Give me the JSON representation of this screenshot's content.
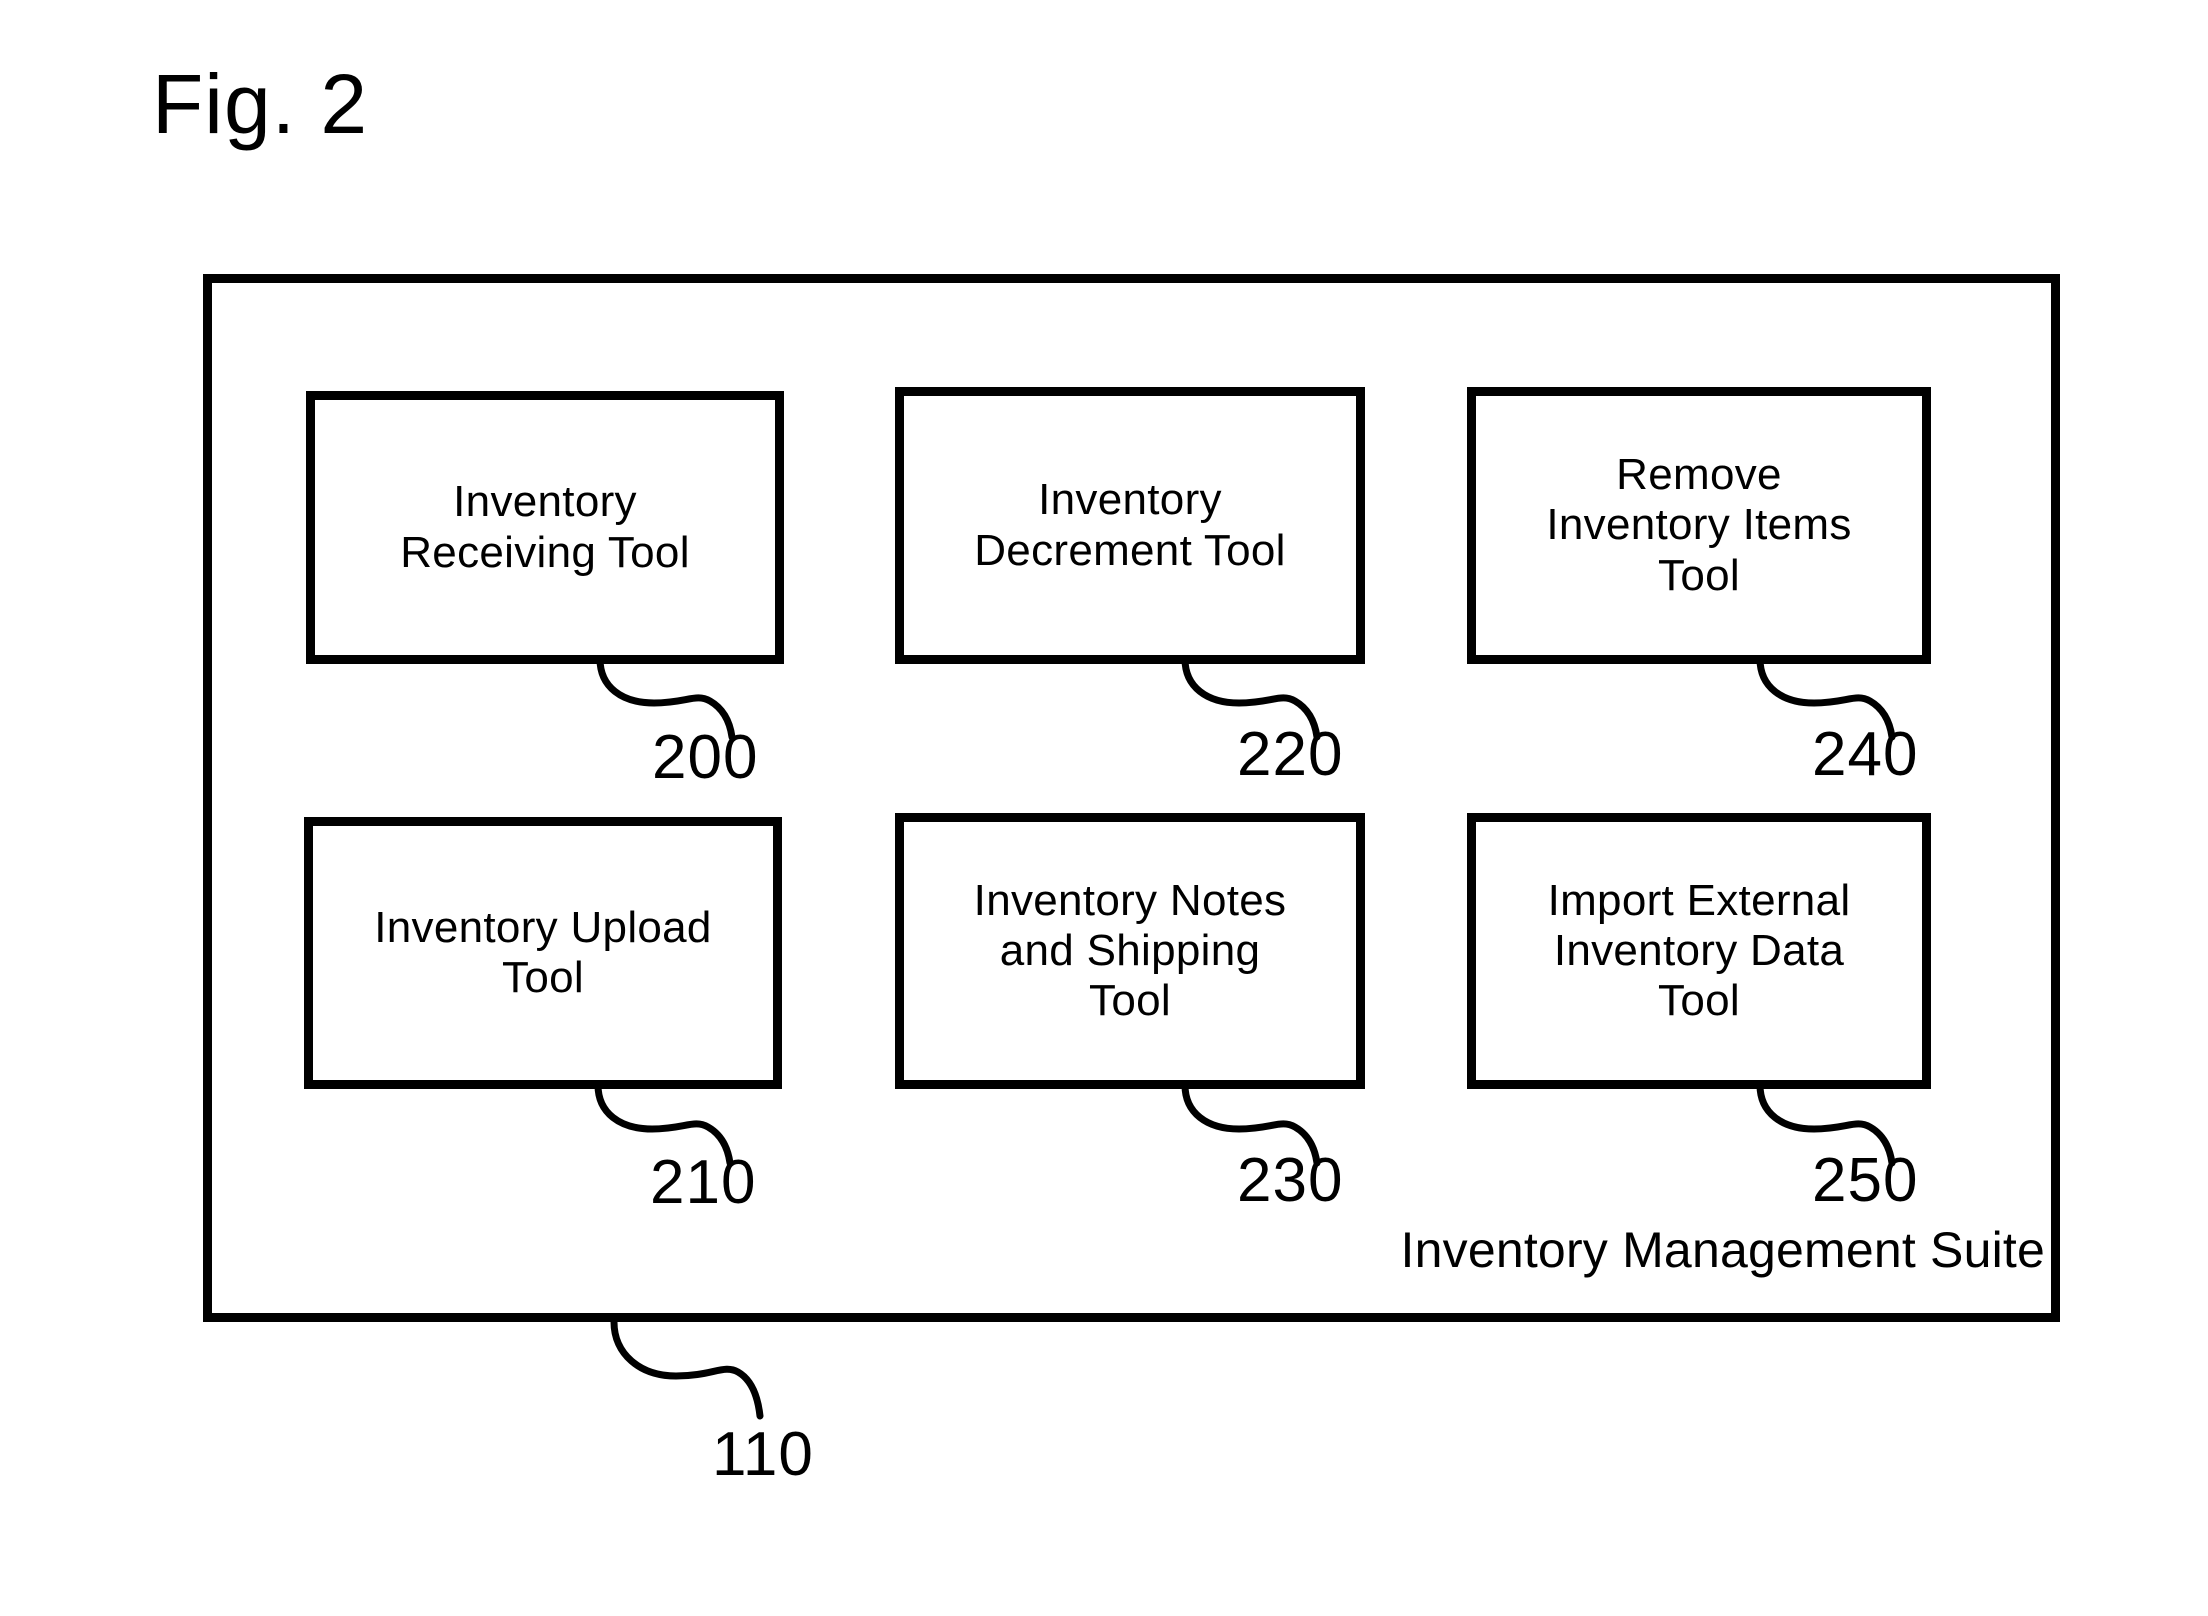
{
  "figure": {
    "title": "Fig. 2"
  },
  "system": {
    "caption": "Inventory Management Suite",
    "ref": "110"
  },
  "tools": [
    {
      "id": "box-200",
      "label": "Inventory\nReceiving Tool",
      "ref": "200"
    },
    {
      "id": "box-220",
      "label": "Inventory\nDecrement Tool",
      "ref": "220"
    },
    {
      "id": "box-240",
      "label": "Remove\nInventory Items\nTool",
      "ref": "240"
    },
    {
      "id": "box-210",
      "label": "Inventory Upload\nTool",
      "ref": "210"
    },
    {
      "id": "box-230",
      "label": "Inventory Notes\nand Shipping\nTool",
      "ref": "230"
    },
    {
      "id": "box-250",
      "label": "Import External\nInventory Data\nTool",
      "ref": "250"
    }
  ],
  "colors": {
    "ink": "#000000",
    "paper": "#ffffff"
  }
}
